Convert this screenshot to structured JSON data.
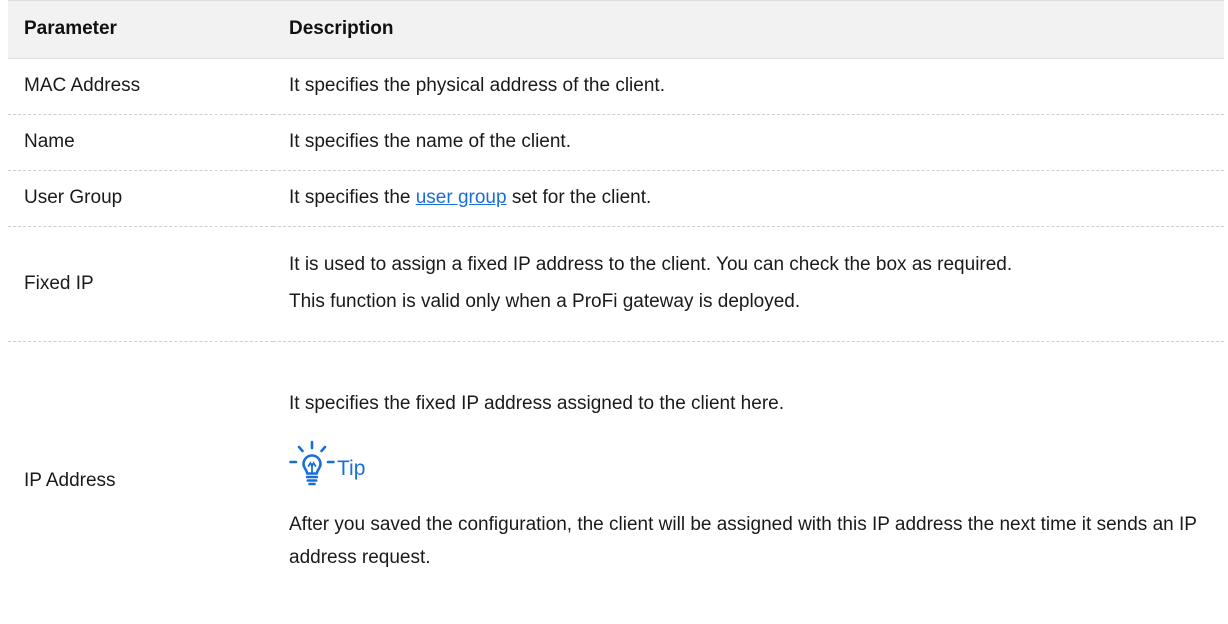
{
  "table": {
    "headers": {
      "parameter": "Parameter",
      "description": "Description"
    },
    "rows": {
      "mac": {
        "parameter": "MAC Address",
        "description": "It specifies the physical address of the client."
      },
      "name": {
        "parameter": "Name",
        "description": "It specifies the name of the client."
      },
      "user_group": {
        "parameter": "User Group",
        "description_prefix": "It specifies the ",
        "description_link": "user group",
        "description_suffix": " set for the client."
      },
      "fixed_ip": {
        "parameter": "Fixed IP",
        "description_line1": "It is used to assign a fixed IP address to the client. You can check the box as required.",
        "description_line2": "This function is valid only when a ProFi gateway is deployed."
      },
      "ip_address": {
        "parameter": "IP Address",
        "description": "It specifies the fixed IP address assigned to the client here.",
        "tip_label": "Tip",
        "tip_text": "After you saved the configuration, the client will be assigned with this IP address the next time it sends an IP address request."
      }
    }
  },
  "icons": {
    "tip": "lightbulb-icon"
  },
  "colors": {
    "header_bg": "#f2f2f2",
    "link": "#1a6fd6",
    "tip": "#1a6fd6",
    "divider": "#cfcfcf"
  }
}
